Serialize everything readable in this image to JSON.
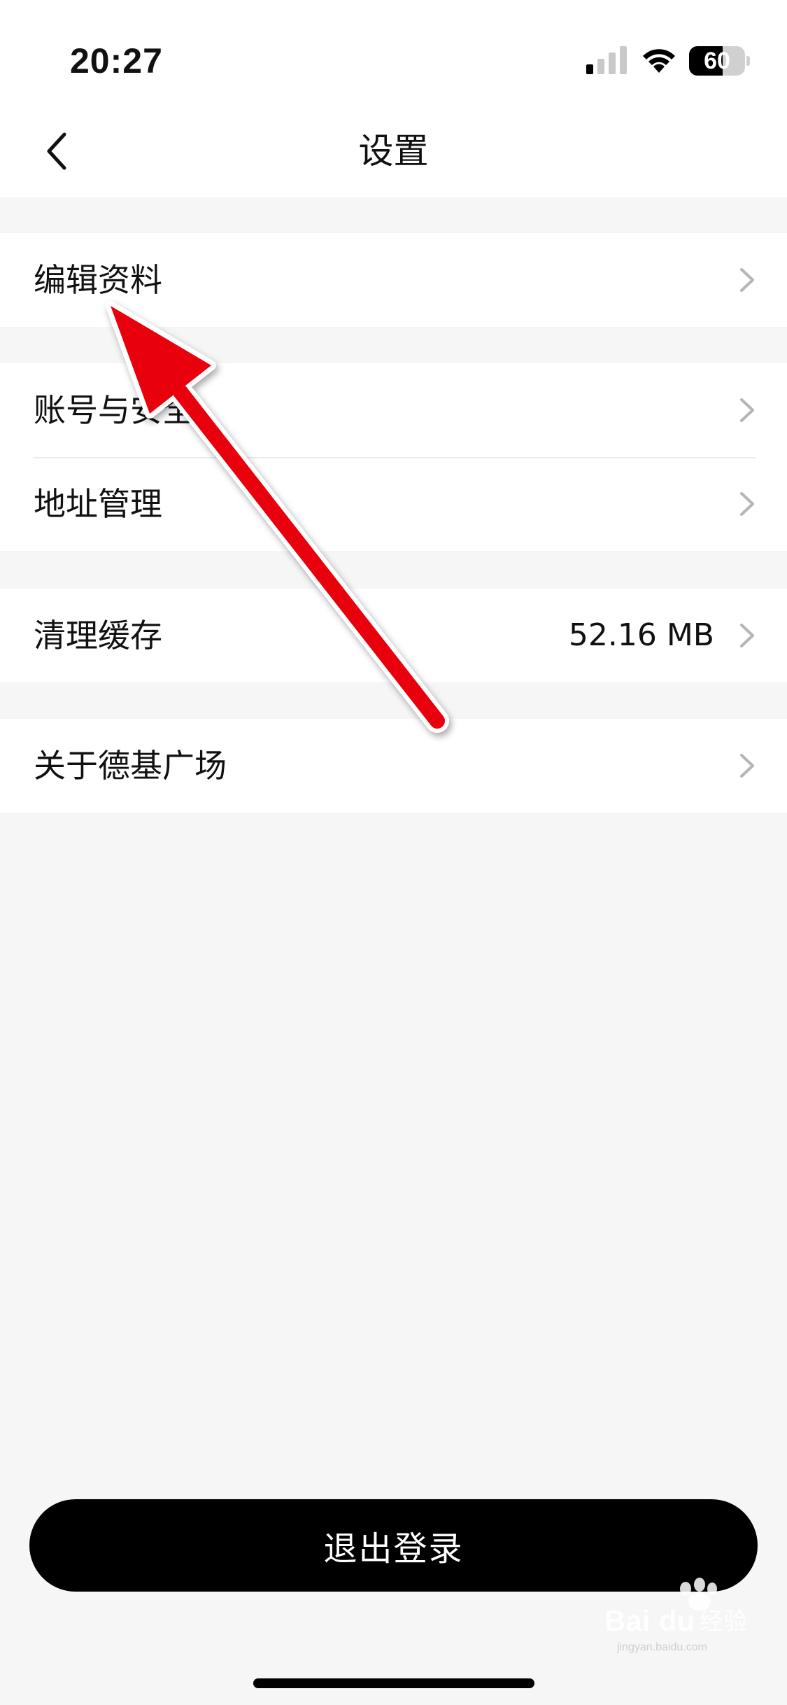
{
  "status_bar": {
    "time": "20:27",
    "battery_level": "60",
    "battery_fraction": 0.6,
    "icons": [
      "signal-icon",
      "wifi-icon",
      "battery-icon"
    ]
  },
  "nav": {
    "title": "设置",
    "back_icon": "chevron-left-icon"
  },
  "settings": {
    "edit_profile": "编辑资料",
    "account_security": "账号与安全",
    "address_management": "地址管理",
    "clear_cache": "清理缓存",
    "cache_size": "52.16 MB",
    "about": "关于德基广场"
  },
  "logout": {
    "label": "退出登录"
  },
  "colors": {
    "background": "#f6f6f6",
    "surface": "#ffffff",
    "text": "#111111",
    "chevron": "#b5b5b5",
    "button": "#000000",
    "annotation_arrow": "#e8000b"
  },
  "watermark": {
    "text": "Baidu经验",
    "subtext": "jingyan.baidu.com"
  }
}
